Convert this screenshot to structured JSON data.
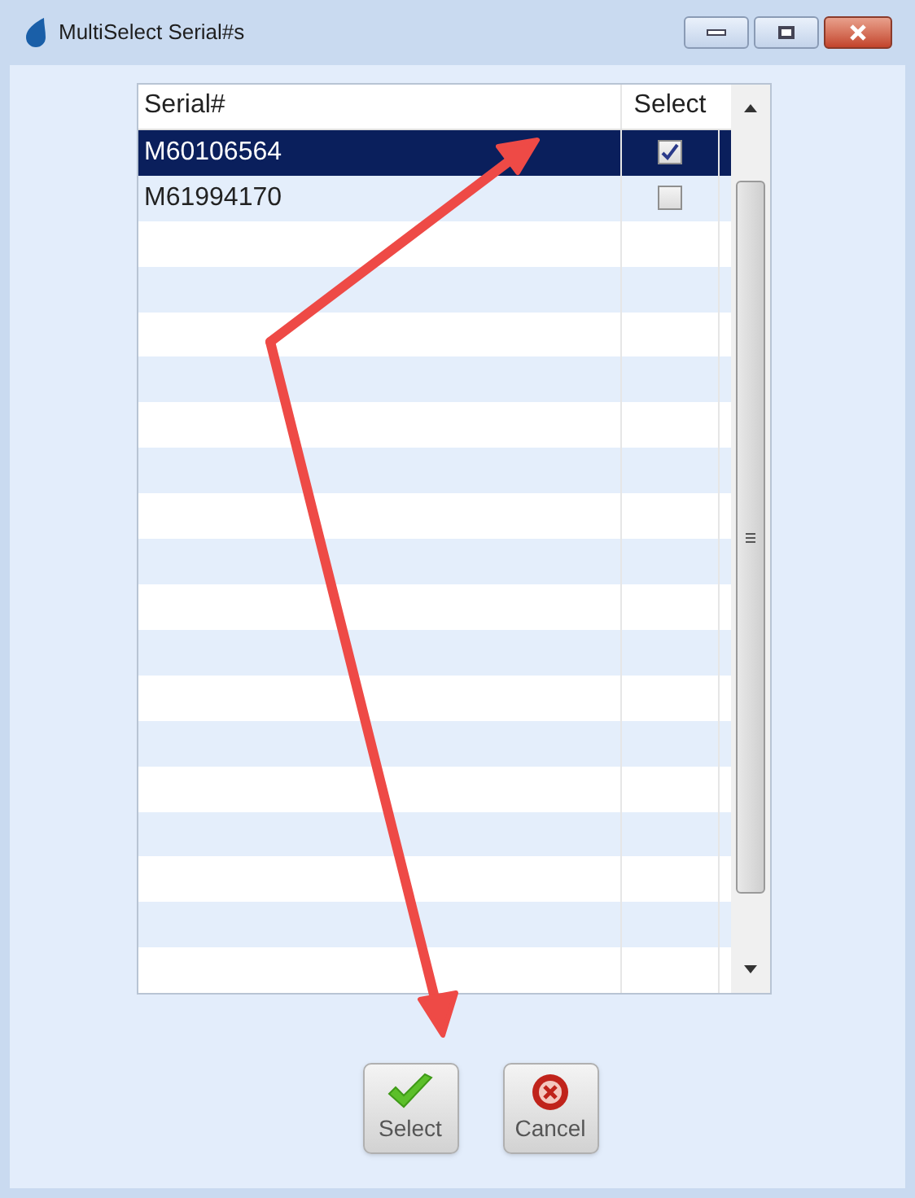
{
  "window": {
    "title": "MultiSelect Serial#s"
  },
  "table": {
    "columns": [
      "Serial#",
      "Select"
    ],
    "rows": [
      {
        "serial": "M60106564",
        "checked": true,
        "selected": true
      },
      {
        "serial": "M61994170",
        "checked": false,
        "selected": false
      }
    ]
  },
  "buttons": [
    {
      "kind": "select",
      "label": "Select"
    },
    {
      "kind": "cancel",
      "label": "Cancel"
    }
  ]
}
